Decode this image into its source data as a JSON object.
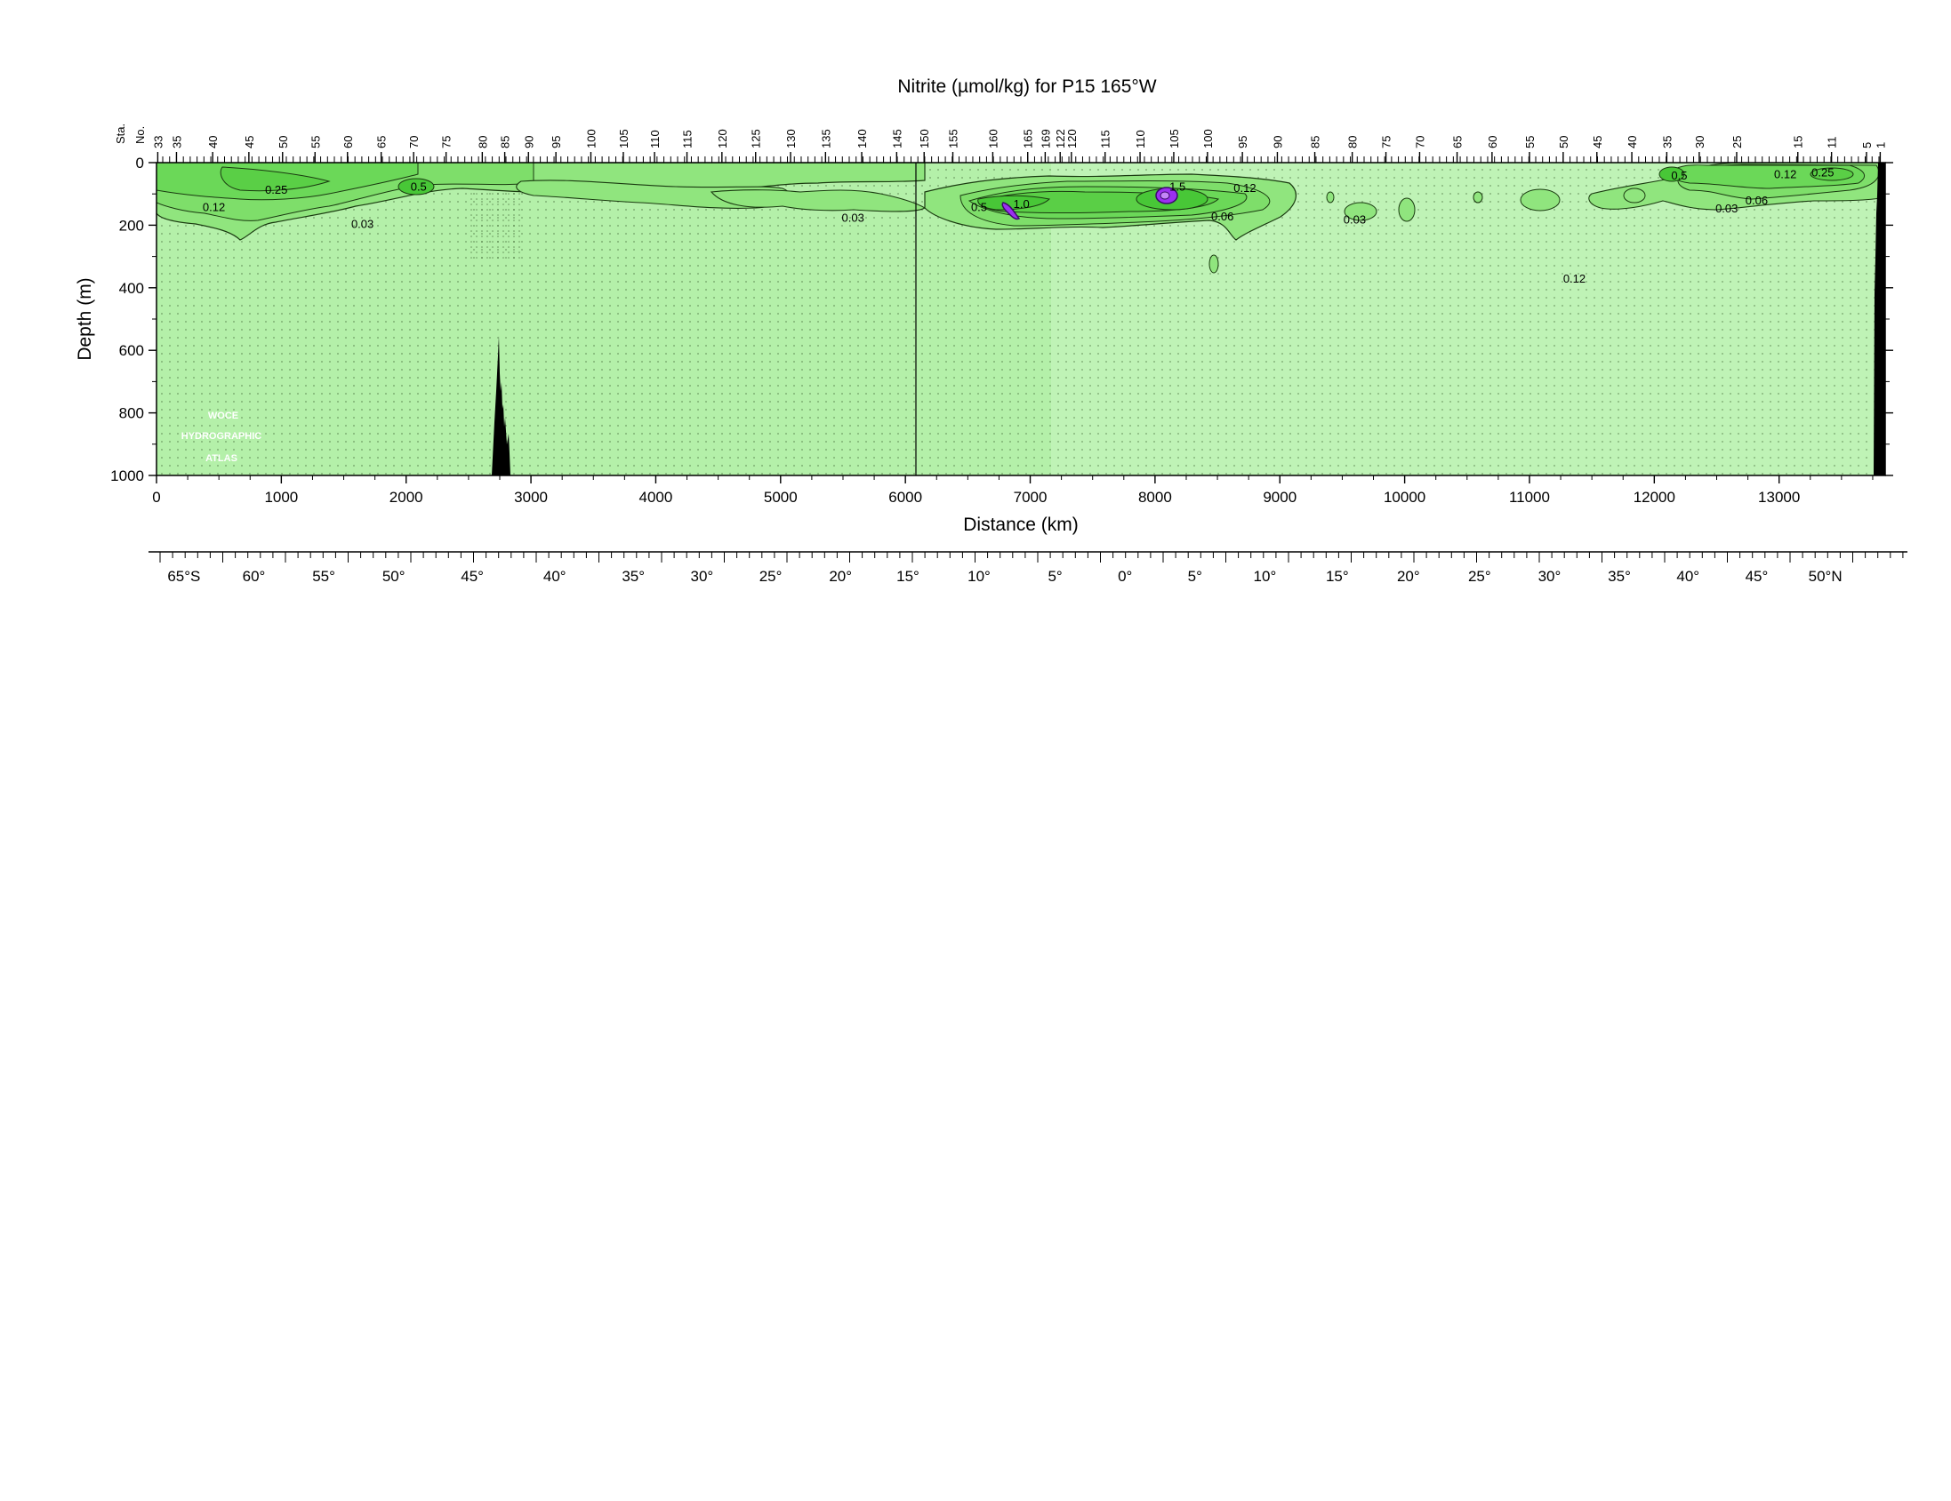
{
  "chart_data": {
    "type": "contour-section",
    "title": "Nitrite (µmol/kg) for P15 165°W",
    "xlabel": "Distance (km)",
    "ylabel": "Depth (m)",
    "station_axis_label": [
      "Sta.",
      "No."
    ],
    "xlim": [
      0,
      13850
    ],
    "ylim": [
      1000,
      0
    ],
    "x_ticks": [
      0,
      1000,
      2000,
      3000,
      4000,
      5000,
      6000,
      7000,
      8000,
      9000,
      10000,
      11000,
      12000,
      13000
    ],
    "y_ticks": [
      0,
      200,
      400,
      600,
      800,
      1000
    ],
    "latitude_labels": [
      {
        "text": "65°S",
        "km": 220
      },
      {
        "text": "60°",
        "km": 780
      },
      {
        "text": "55°",
        "km": 1340
      },
      {
        "text": "50°",
        "km": 1900
      },
      {
        "text": "45°",
        "km": 2530
      },
      {
        "text": "40°",
        "km": 3190
      },
      {
        "text": "35°",
        "km": 3820
      },
      {
        "text": "30°",
        "km": 4370
      },
      {
        "text": "25°",
        "km": 4920
      },
      {
        "text": "20°",
        "km": 5480
      },
      {
        "text": "15°",
        "km": 6020
      },
      {
        "text": "10°",
        "km": 6590
      },
      {
        "text": "5°",
        "km": 7200
      },
      {
        "text": "0°",
        "km": 7760
      },
      {
        "text": "5°",
        "km": 8320
      },
      {
        "text": "10°",
        "km": 8880
      },
      {
        "text": "15°",
        "km": 9460
      },
      {
        "text": "20°",
        "km": 10030
      },
      {
        "text": "25°",
        "km": 10600
      },
      {
        "text": "30°",
        "km": 11160
      },
      {
        "text": "35°",
        "km": 11720
      },
      {
        "text": "40°",
        "km": 12270
      },
      {
        "text": "45°",
        "km": 12820
      },
      {
        "text": "50°N",
        "km": 13370
      }
    ],
    "stations": [
      {
        "no": "33",
        "km": 10
      },
      {
        "no": "35",
        "km": 160
      },
      {
        "no": "40",
        "km": 450
      },
      {
        "no": "45",
        "km": 740
      },
      {
        "no": "50",
        "km": 1010
      },
      {
        "no": "55",
        "km": 1270
      },
      {
        "no": "60",
        "km": 1530
      },
      {
        "no": "65",
        "km": 1800
      },
      {
        "no": "70",
        "km": 2060
      },
      {
        "no": "75",
        "km": 2320
      },
      {
        "no": "80",
        "km": 2610
      },
      {
        "no": "85",
        "km": 2790
      },
      {
        "no": "90",
        "km": 2980
      },
      {
        "no": "95",
        "km": 3200
      },
      {
        "no": "100",
        "km": 3480
      },
      {
        "no": "105",
        "km": 3740
      },
      {
        "no": "110",
        "km": 3990
      },
      {
        "no": "115",
        "km": 4250
      },
      {
        "no": "120",
        "km": 4530
      },
      {
        "no": "125",
        "km": 4800
      },
      {
        "no": "130",
        "km": 5080
      },
      {
        "no": "135",
        "km": 5360
      },
      {
        "no": "140",
        "km": 5650
      },
      {
        "no": "145",
        "km": 5930
      },
      {
        "no": "150",
        "km": 6150
      },
      {
        "no": "155",
        "km": 6380
      },
      {
        "no": "160",
        "km": 6700
      },
      {
        "no": "165",
        "km": 6980
      },
      {
        "no": "169",
        "km": 7120
      },
      {
        "no": "122",
        "km": 7240
      },
      {
        "no": "120",
        "km": 7330
      },
      {
        "no": "115",
        "km": 7600
      },
      {
        "no": "110",
        "km": 7880
      },
      {
        "no": "105",
        "km": 8150
      },
      {
        "no": "100",
        "km": 8420
      },
      {
        "no": "95",
        "km": 8700
      },
      {
        "no": "90",
        "km": 8980
      },
      {
        "no": "85",
        "km": 9280
      },
      {
        "no": "80",
        "km": 9580
      },
      {
        "no": "75",
        "km": 9850
      },
      {
        "no": "70",
        "km": 10120
      },
      {
        "no": "65",
        "km": 10420
      },
      {
        "no": "60",
        "km": 10700
      },
      {
        "no": "55",
        "km": 11000
      },
      {
        "no": "50",
        "km": 11270
      },
      {
        "no": "45",
        "km": 11540
      },
      {
        "no": "40",
        "km": 11820
      },
      {
        "no": "35",
        "km": 12100
      },
      {
        "no": "30",
        "km": 12360
      },
      {
        "no": "25",
        "km": 12660
      },
      {
        "no": "15",
        "km": 13150
      },
      {
        "no": "11",
        "km": 13420
      },
      {
        "no": "5",
        "km": 13700
      },
      {
        "no": "1",
        "km": 13810
      }
    ],
    "contour_levels": [
      0.03,
      0.06,
      0.12,
      0.25,
      0.5,
      1.0,
      1.5
    ],
    "colors": {
      "background": "#bff3b6",
      "low": "#90e57e",
      "mid": "#6bd858",
      "high": "#48c737",
      "extreme": "#9b30f0",
      "extreme_core": "#c486f8",
      "bottom": "#000000"
    },
    "contour_labels": [
      {
        "text": "0.12",
        "km": 460,
        "depth": 140
      },
      {
        "text": "0.25",
        "km": 960,
        "depth": 85
      },
      {
        "text": "0.03",
        "km": 1650,
        "depth": 195
      },
      {
        "text": "0.5",
        "km": 2100,
        "depth": 75
      },
      {
        "text": "0.03",
        "km": 5580,
        "depth": 175
      },
      {
        "text": "0.5",
        "km": 6590,
        "depth": 140
      },
      {
        "text": "1.0",
        "km": 6930,
        "depth": 130
      },
      {
        "text": "1.5",
        "km": 8180,
        "depth": 75
      },
      {
        "text": "0.12",
        "km": 8720,
        "depth": 80
      },
      {
        "text": "0.06",
        "km": 8540,
        "depth": 170
      },
      {
        "text": "0.03",
        "km": 9600,
        "depth": 180
      },
      {
        "text": "0.12",
        "km": 11360,
        "depth": 370
      },
      {
        "text": "0.5",
        "km": 12200,
        "depth": 40
      },
      {
        "text": "0.12",
        "km": 13050,
        "depth": 35
      },
      {
        "text": "0.25",
        "km": 13350,
        "depth": 30
      },
      {
        "text": "0.03",
        "km": 12580,
        "depth": 145
      },
      {
        "text": "0.06",
        "km": 12820,
        "depth": 120
      }
    ],
    "watermark": [
      "WOCE",
      "HYDROGRAPHIC",
      "ATLAS"
    ]
  }
}
